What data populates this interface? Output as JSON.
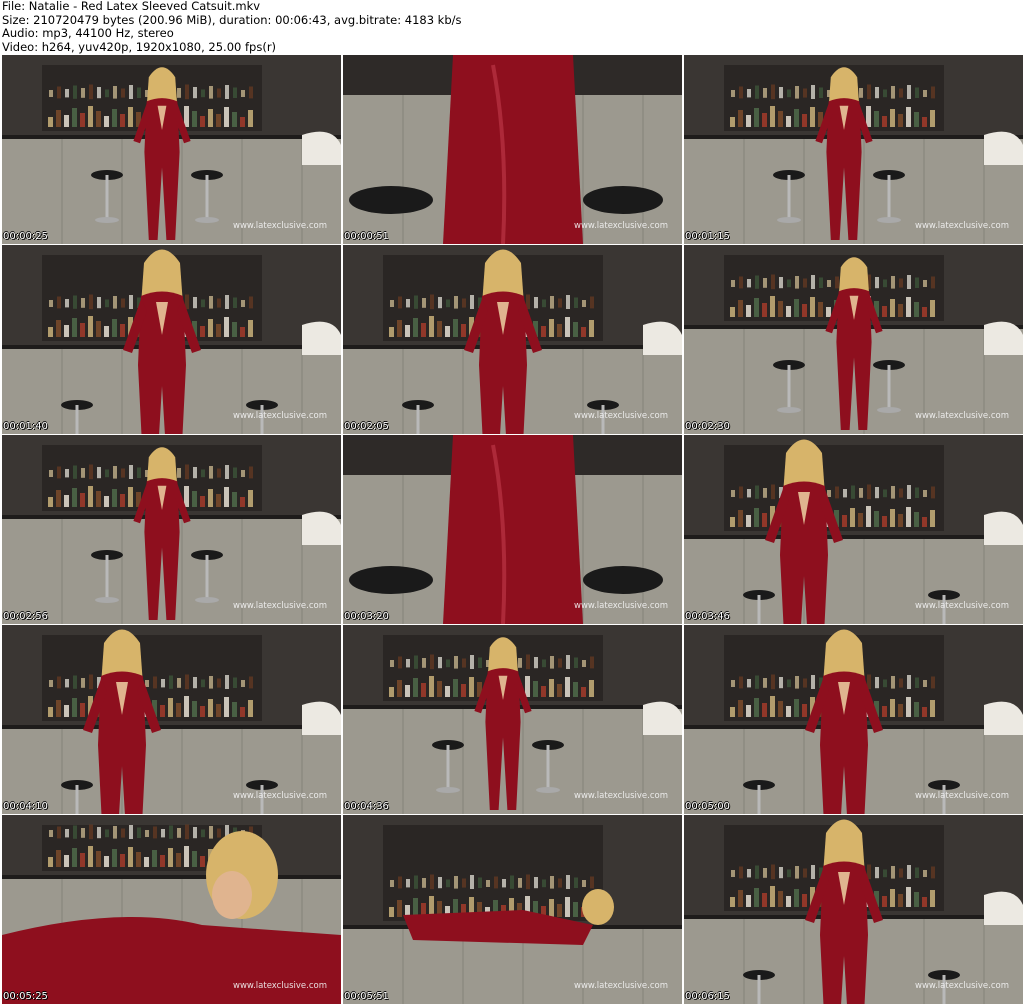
{
  "header": {
    "file": "File: Natalie - Red Latex Sleeved Catsuit.mkv",
    "size": "Size: 210720479 bytes (200.96 MiB), duration: 00:06:43, avg.bitrate: 4183 kb/s",
    "audio": "Audio: mp3, 44100 Hz, stereo",
    "video": "Video: h264, yuv420p, 1920x1080, 25.00 fps(r)"
  },
  "watermark": "www.latexclusive.com",
  "colors": {
    "latex": "#8e0f1e",
    "wall": "#6d6a63",
    "bar_back": "#2a2624",
    "counter": "#9c998f"
  },
  "thumbnails": [
    {
      "time": "00:00:25",
      "scene": "wide-standing"
    },
    {
      "time": "00:00:51",
      "scene": "closeup-torso"
    },
    {
      "time": "00:01:15",
      "scene": "wide-standing"
    },
    {
      "time": "00:01:40",
      "scene": "medium-standing"
    },
    {
      "time": "00:02:05",
      "scene": "medium-standing"
    },
    {
      "time": "00:02:30",
      "scene": "leaning-stool"
    },
    {
      "time": "00:02:56",
      "scene": "wide-standing"
    },
    {
      "time": "00:03:20",
      "scene": "closeup-hips"
    },
    {
      "time": "00:03:46",
      "scene": "sitting-stool"
    },
    {
      "time": "00:04:10",
      "scene": "sitting-back"
    },
    {
      "time": "00:04:36",
      "scene": "sitting-bar"
    },
    {
      "time": "00:05:00",
      "scene": "medium-standing-dark"
    },
    {
      "time": "00:05:25",
      "scene": "lying-closeup"
    },
    {
      "time": "00:05:51",
      "scene": "lying-bar"
    },
    {
      "time": "00:06:15",
      "scene": "medium-standing"
    }
  ]
}
